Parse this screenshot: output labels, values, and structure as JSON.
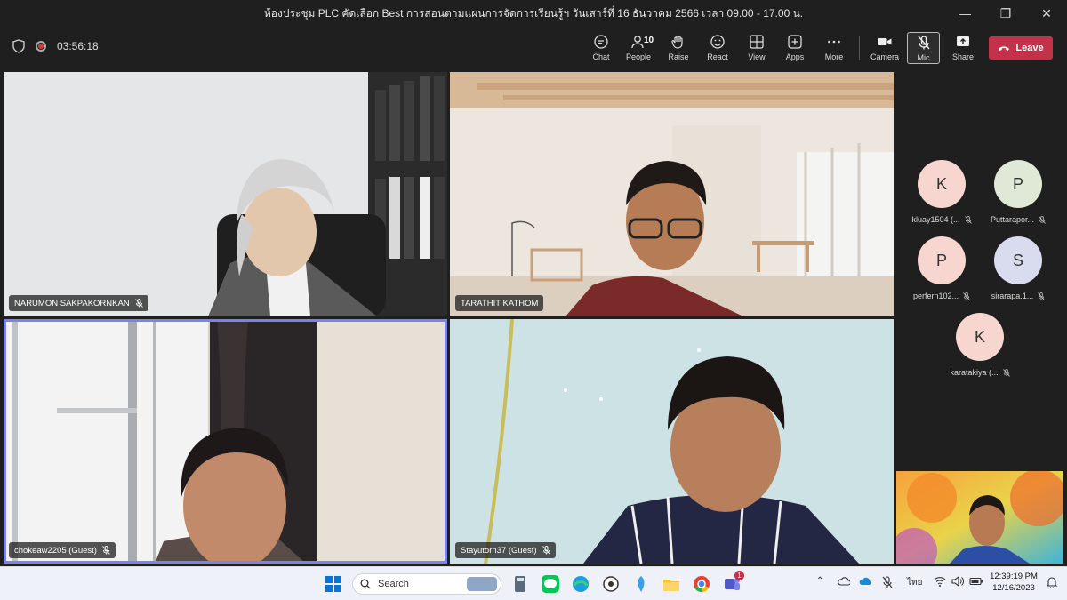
{
  "window": {
    "title": "ห้องประชุม PLC คัดเลือก Best การสอนตามแผนการจัดการเรียนรู้ฯ วันเสาร์ที่ 16 ธันวาคม 2566 เวลา 09.00 - 17.00 น.",
    "controls": [
      "minimize",
      "restore",
      "close"
    ]
  },
  "toolbar": {
    "timer": "03:56:18",
    "buttons": [
      {
        "label": "Chat",
        "icon": "chat-icon"
      },
      {
        "label": "People",
        "icon": "people-icon",
        "count": "10"
      },
      {
        "label": "Raise",
        "icon": "hand-icon"
      },
      {
        "label": "React",
        "icon": "smile-icon"
      },
      {
        "label": "View",
        "icon": "grid-icon"
      },
      {
        "label": "Apps",
        "icon": "plus-square-icon"
      },
      {
        "label": "More",
        "icon": "more-icon"
      },
      {
        "label": "Camera",
        "icon": "camera-icon"
      },
      {
        "label": "Mic",
        "icon": "mic-off-icon"
      },
      {
        "label": "Share",
        "icon": "share-icon"
      }
    ],
    "leave_label": "Leave"
  },
  "tiles": [
    {
      "name": "NARUMON SAKPAKORNKAN",
      "muted": true
    },
    {
      "name": "TARATHIT KATHOM",
      "muted": false
    },
    {
      "name": "chokeaw2205 (Guest)",
      "muted": true
    },
    {
      "name": "Stayutorn37 (Guest)",
      "muted": true
    }
  ],
  "rail": {
    "participants": [
      {
        "initial": "K",
        "name": "kluay1504 (...",
        "color": "#f6d6cf"
      },
      {
        "initial": "P",
        "name": "Puttarapor...",
        "color": "#dfe9d6"
      },
      {
        "initial": "P",
        "name": "perfern102...",
        "color": "#f6d6cf"
      },
      {
        "initial": "S",
        "name": "sirarapa.1...",
        "color": "#d9dcef"
      },
      {
        "initial": "K",
        "name": "karatakiya (...",
        "color": "#f6d6cf"
      }
    ]
  },
  "taskbar": {
    "search_label": "Search",
    "language": "ไทย",
    "time": "12:39:19 PM",
    "date": "12/16/2023",
    "teams_badge": "1"
  }
}
